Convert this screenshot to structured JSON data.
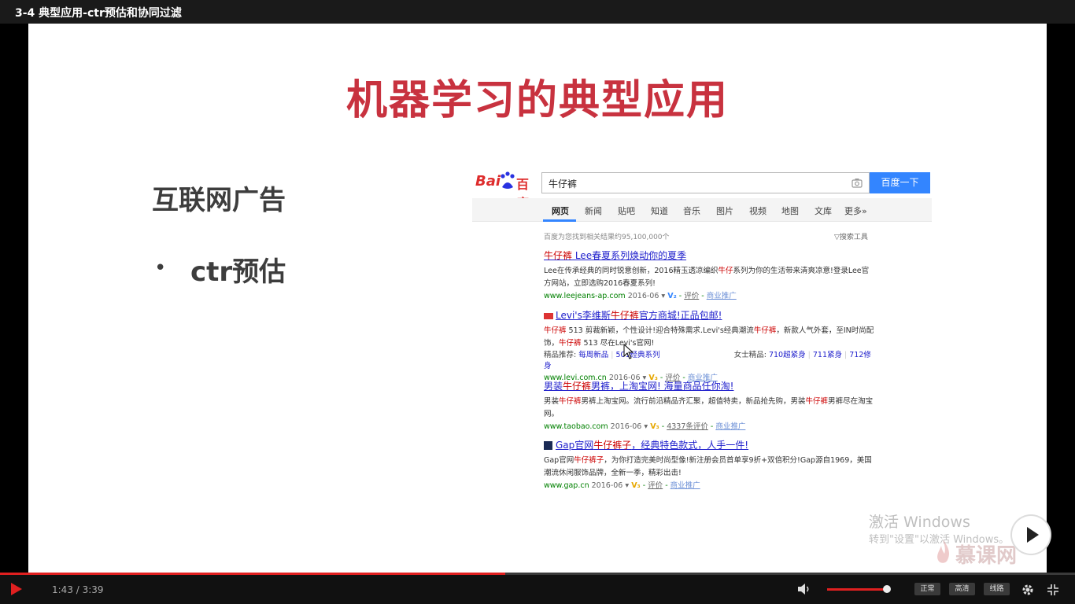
{
  "window": {
    "title": "3-4 典型应用-ctr预估和协同过滤"
  },
  "slide": {
    "heading": "机器学习的典型应用",
    "subtitle": "互联网广告",
    "bullet_mark": "•",
    "bullet_text": "ctr预估"
  },
  "baidu": {
    "logo_left": "Bai",
    "logo_right": "百度",
    "query": "牛仔裤",
    "search_button": "百度一下",
    "tabs": [
      "网页",
      "新闻",
      "贴吧",
      "知道",
      "音乐",
      "图片",
      "视频",
      "地图",
      "文库",
      "更多»"
    ],
    "result_count": "百度为您找到相关结果约95,100,000个",
    "search_tools": "▽搜索工具",
    "results": [
      {
        "title_red": "牛仔裤",
        "title_rest": " Lee春夏系列焕动你的夏季",
        "desc_a": "Lee在传承经典的同时锐意创新，2016精玉透凉编织",
        "desc_red": "牛仔",
        "desc_b": "系列为你的生活带来清爽凉意!登录Lee官方网站，立即选购2016春夏系列!",
        "url": "www.leejeans-ap.com",
        "date": "2016-06",
        "v": "V₂",
        "review": "评价",
        "promo": "商业推广"
      },
      {
        "title_a": "Levi's李维斯",
        "title_red": "牛仔裤",
        "title_rest": "官方商城!正品包邮!",
        "desc_red1": "牛仔裤",
        "desc_a": " 513 剪裁新颖，个性设计!迎合特殊需求.Levi's经典潮流",
        "desc_red2": "牛仔裤",
        "desc_b": "，新款人气外套，至IN时尚配饰，",
        "desc_red3": "牛仔裤",
        "desc_c": " 513 尽在Levi's官网!",
        "rec_label": "精品推荐:",
        "rec_1": "每周新品",
        "rec_2": "501经典系列",
        "rec_label2": "女士精品:",
        "rec_3": "710超紧身",
        "rec_4": "711紧身",
        "rec_5": "712修身",
        "url": "www.levi.com.cn",
        "date": "2016-06",
        "v": "V₃",
        "review": "评价",
        "promo": "商业推广"
      },
      {
        "title_a": "男装",
        "title_red": "牛仔裤",
        "title_rest": "男裤，上淘宝网! 海量商品任你淘!",
        "desc_a": "男装",
        "desc_red1": "牛仔裤",
        "desc_b": "男裤上淘宝网。流行前沿精品齐汇聚，超值特卖，新品抢先购，男装",
        "desc_red2": "牛仔裤",
        "desc_c": "男裤尽在淘宝网。",
        "url": "www.taobao.com",
        "date": "2016-06",
        "v": "V₃",
        "review": "4337条评价",
        "promo": "商业推广"
      },
      {
        "title_a": "Gap官网",
        "title_red": "牛仔裤子",
        "title_rest": "，经典特色款式，人手一件!",
        "desc_a": "Gap官网",
        "desc_red": "牛仔裤子",
        "desc_b": "，为你打造完美时尚型像!新注册会员首单享9折+双倍积分!Gap源自1969，美国潮流休闲服饰品牌，全新一季，精彩出击!",
        "url": "www.gap.cn",
        "date": "2016-06",
        "v": "V₃",
        "review": "评价",
        "promo": "商业推广"
      }
    ]
  },
  "watermark": {
    "line1": "激活 Windows",
    "line2": "转到\"设置\"以激活 Windows。",
    "brand": "慕课网"
  },
  "player": {
    "time": "1:43 / 3:39",
    "progress": 0.47,
    "volume": 0.95,
    "quality_normal": "正常",
    "quality_hd": "高清",
    "route": "线路",
    "accent_color": "#e02020"
  }
}
